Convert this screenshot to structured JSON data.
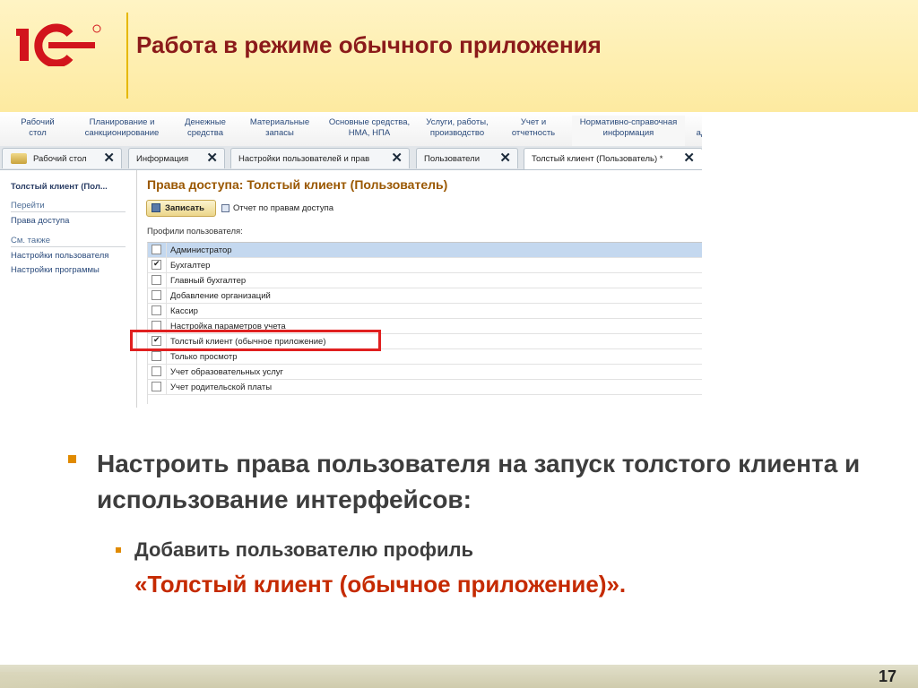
{
  "slide": {
    "title": "Работа в режиме обычного приложения",
    "page_number": "17",
    "logo_text": "1С"
  },
  "sections": [
    {
      "label": "Рабочий стол"
    },
    {
      "label": "Планирование и санкционирование"
    },
    {
      "label": "Денежные средства"
    },
    {
      "label": "Материальные запасы"
    },
    {
      "label": "Основные средства, НМА, НПА"
    },
    {
      "label": "Услуги, работы, производство"
    },
    {
      "label": "Учет и отчетность"
    },
    {
      "label": "Нормативно-справочная информация"
    },
    {
      "label": "ад"
    }
  ],
  "tabs": [
    {
      "label": "Рабочий стол",
      "icon": "desktop-icon"
    },
    {
      "label": "Информация"
    },
    {
      "label": "Настройки пользователей и прав"
    },
    {
      "label": "Пользователи"
    },
    {
      "label": "Толстый клиент (Пользователь) *"
    }
  ],
  "sidepanel": {
    "title": "Толстый клиент (Пол...",
    "goto_header": "Перейти",
    "goto_links": [
      "Права доступа"
    ],
    "see_also_header": "См. также",
    "see_also_links": [
      "Настройки пользователя",
      "Настройки программы"
    ]
  },
  "form": {
    "title": "Права доступа: Толстый клиент (Пользователь)",
    "save_button": "Записать",
    "report_link": "Отчет по правам доступа",
    "profiles_label": "Профили пользователя:",
    "profiles": [
      {
        "label": "Администратор",
        "checked": false,
        "selected": true
      },
      {
        "label": "Бухгалтер",
        "checked": true
      },
      {
        "label": "Главный бухгалтер",
        "checked": false
      },
      {
        "label": "Добавление организаций",
        "checked": false
      },
      {
        "label": "Кассир",
        "checked": false
      },
      {
        "label": "Настройка параметров учета",
        "checked": false
      },
      {
        "label": "Толстый клиент (обычное приложение)",
        "checked": true
      },
      {
        "label": "Только просмотр",
        "checked": false
      },
      {
        "label": "Учет образовательных услуг",
        "checked": false
      },
      {
        "label": "Учет родительской платы",
        "checked": false
      }
    ]
  },
  "bullets": {
    "main": "Настроить права пользователя на запуск толстого клиента и использование интерфейсов:",
    "sub_line1": "Добавить пользователю профиль",
    "sub_line2": "«Толстый клиент (обычное приложение)»."
  },
  "colors": {
    "title": "#8b1a1a",
    "accent": "#e08a00",
    "highlight": "#e02020",
    "emphasis": "#c52a00"
  }
}
